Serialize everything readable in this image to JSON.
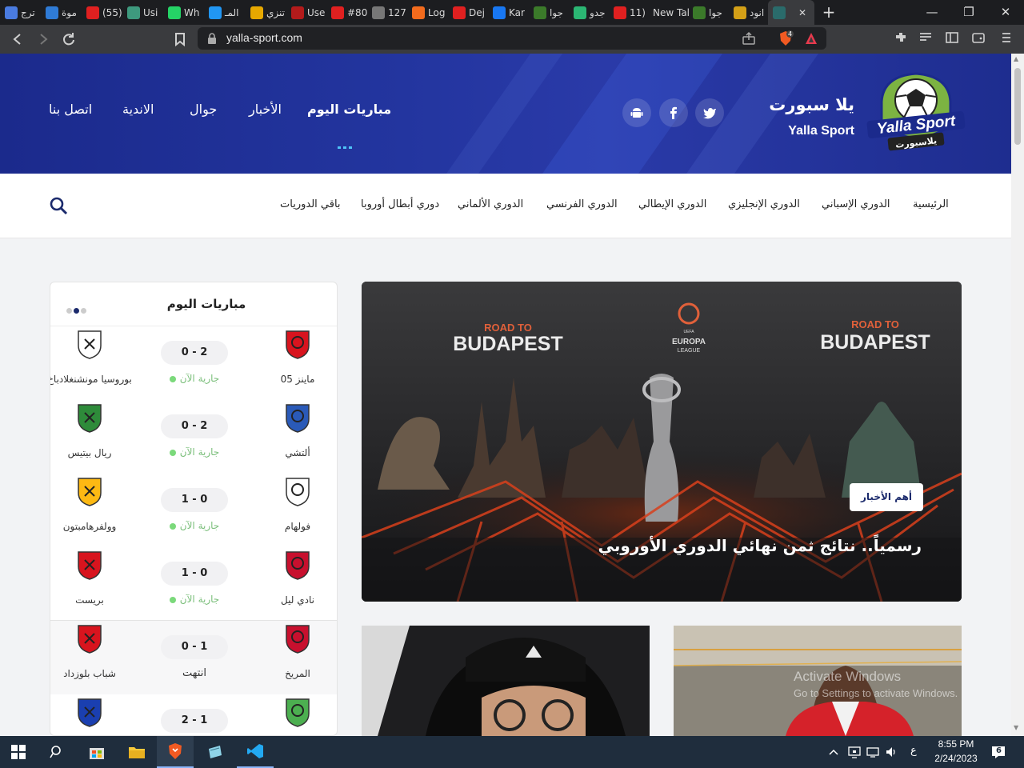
{
  "browser": {
    "tabs": [
      {
        "label": "ترج",
        "icon": "translate-icon",
        "color": "#4a7be0"
      },
      {
        "label": "موة",
        "icon": "site-icon",
        "color": "#2f7bd6"
      },
      {
        "label": "(55)",
        "icon": "youtube-icon",
        "color": "#e02020"
      },
      {
        "label": "Usi",
        "icon": "openai-icon",
        "color": "#3e9a7e"
      },
      {
        "label": "Wh",
        "icon": "whatsapp-icon",
        "color": "#25d366"
      },
      {
        "label": "المـ",
        "icon": "circle-icon",
        "color": "#2196f3"
      },
      {
        "label": "تنزي",
        "icon": "five-icon",
        "color": "#e6a800"
      },
      {
        "label": "Use",
        "icon": "mi-icon",
        "color": "#b31b1b"
      },
      {
        "label": "#80",
        "icon": "youtube-icon",
        "color": "#e02020"
      },
      {
        "label": "127",
        "icon": "globe-icon",
        "color": "#777777"
      },
      {
        "label": "Log",
        "icon": "n-icon",
        "color": "#f26b1d"
      },
      {
        "label": "Dej",
        "icon": "youtube-icon",
        "color": "#e02020"
      },
      {
        "label": "Kar",
        "icon": "facebook-icon",
        "color": "#1877f2"
      },
      {
        "label": "جوا",
        "icon": "yalla-icon",
        "color": "#3b7a2a"
      },
      {
        "label": "جدو",
        "icon": "check-icon",
        "color": "#2bb673"
      },
      {
        "label": "11)",
        "icon": "youtube-icon",
        "color": "#e02020"
      },
      {
        "label": "New Tal",
        "icon": "",
        "color": ""
      },
      {
        "label": "جوا",
        "icon": "yalla-icon",
        "color": "#3b7a2a"
      },
      {
        "label": "انود",
        "icon": "ball-icon",
        "color": "#d4a017"
      },
      {
        "label": "",
        "icon": "yalla-icon",
        "color": "#2a6b6b"
      }
    ],
    "url": "yalla-sport.com",
    "shield_badge": "4"
  },
  "header": {
    "brand_ar": "يلا سبورت",
    "brand_en": "Yalla Sport",
    "logo_text": "Yalla Sport",
    "logo_sub": "يلاسبورت",
    "nav": [
      {
        "label": "مباريات اليوم",
        "active": true
      },
      {
        "label": "الأخبار",
        "active": false
      },
      {
        "label": "جوال",
        "active": false
      },
      {
        "label": "الاندية",
        "active": false
      },
      {
        "label": "اتصل بنا",
        "active": false
      }
    ],
    "social": [
      "twitter-icon",
      "facebook-icon",
      "android-icon"
    ]
  },
  "subnav": {
    "items": [
      "الرئيسية",
      "الدوري الإسباني",
      "الدوري الإنجليزي",
      "الدوري الإيطالي",
      "الدوري الفرنسي",
      "الدوري الألماني",
      "دوري أبطال أوروبا",
      "باقي الدوريات"
    ]
  },
  "matches": {
    "title": "مباريات اليوم",
    "rows": [
      {
        "home": "ماينز 05",
        "away": "بوروسيا مونشنغلادباخ",
        "score": "0 - 2",
        "status": "جارية الآن",
        "live": true
      },
      {
        "home": "ألتشي",
        "away": "ريال بيتيس",
        "score": "0 - 2",
        "status": "جارية الآن",
        "live": true
      },
      {
        "home": "فولهام",
        "away": "وولفرهامبتون",
        "score": "1 - 0",
        "status": "جارية الآن",
        "live": true
      },
      {
        "home": "نادي ليل",
        "away": "بريست",
        "score": "1 - 0",
        "status": "جارية الآن",
        "live": true
      },
      {
        "home": "المريخ",
        "away": "شباب بلوزداد",
        "score": "0 - 1",
        "status": "انتهت",
        "live": false
      },
      {
        "home": "",
        "away": "",
        "score": "2 - 1",
        "status": "",
        "live": false
      }
    ]
  },
  "featured": {
    "badge": "أهم الأخبار",
    "headline": "رسمياً.. نتائج ثمن نهائي الدوري الأوروبي",
    "poster_left_top": "ROAD TO",
    "poster_left_main": "BUDAPEST",
    "poster_right_top": "ROAD TO",
    "poster_right_main": "BUDAPEST",
    "poster_center_1": "EUROPA",
    "poster_center_2": "LEAGUE",
    "poster_center_uefa": "UEFA"
  },
  "watermark": {
    "line1": "Activate Windows",
    "line2": "Go to Settings to activate Windows."
  },
  "taskbar": {
    "time": "8:55 PM",
    "date": "2/24/2023",
    "lang": "ع",
    "notif_count": "6"
  }
}
